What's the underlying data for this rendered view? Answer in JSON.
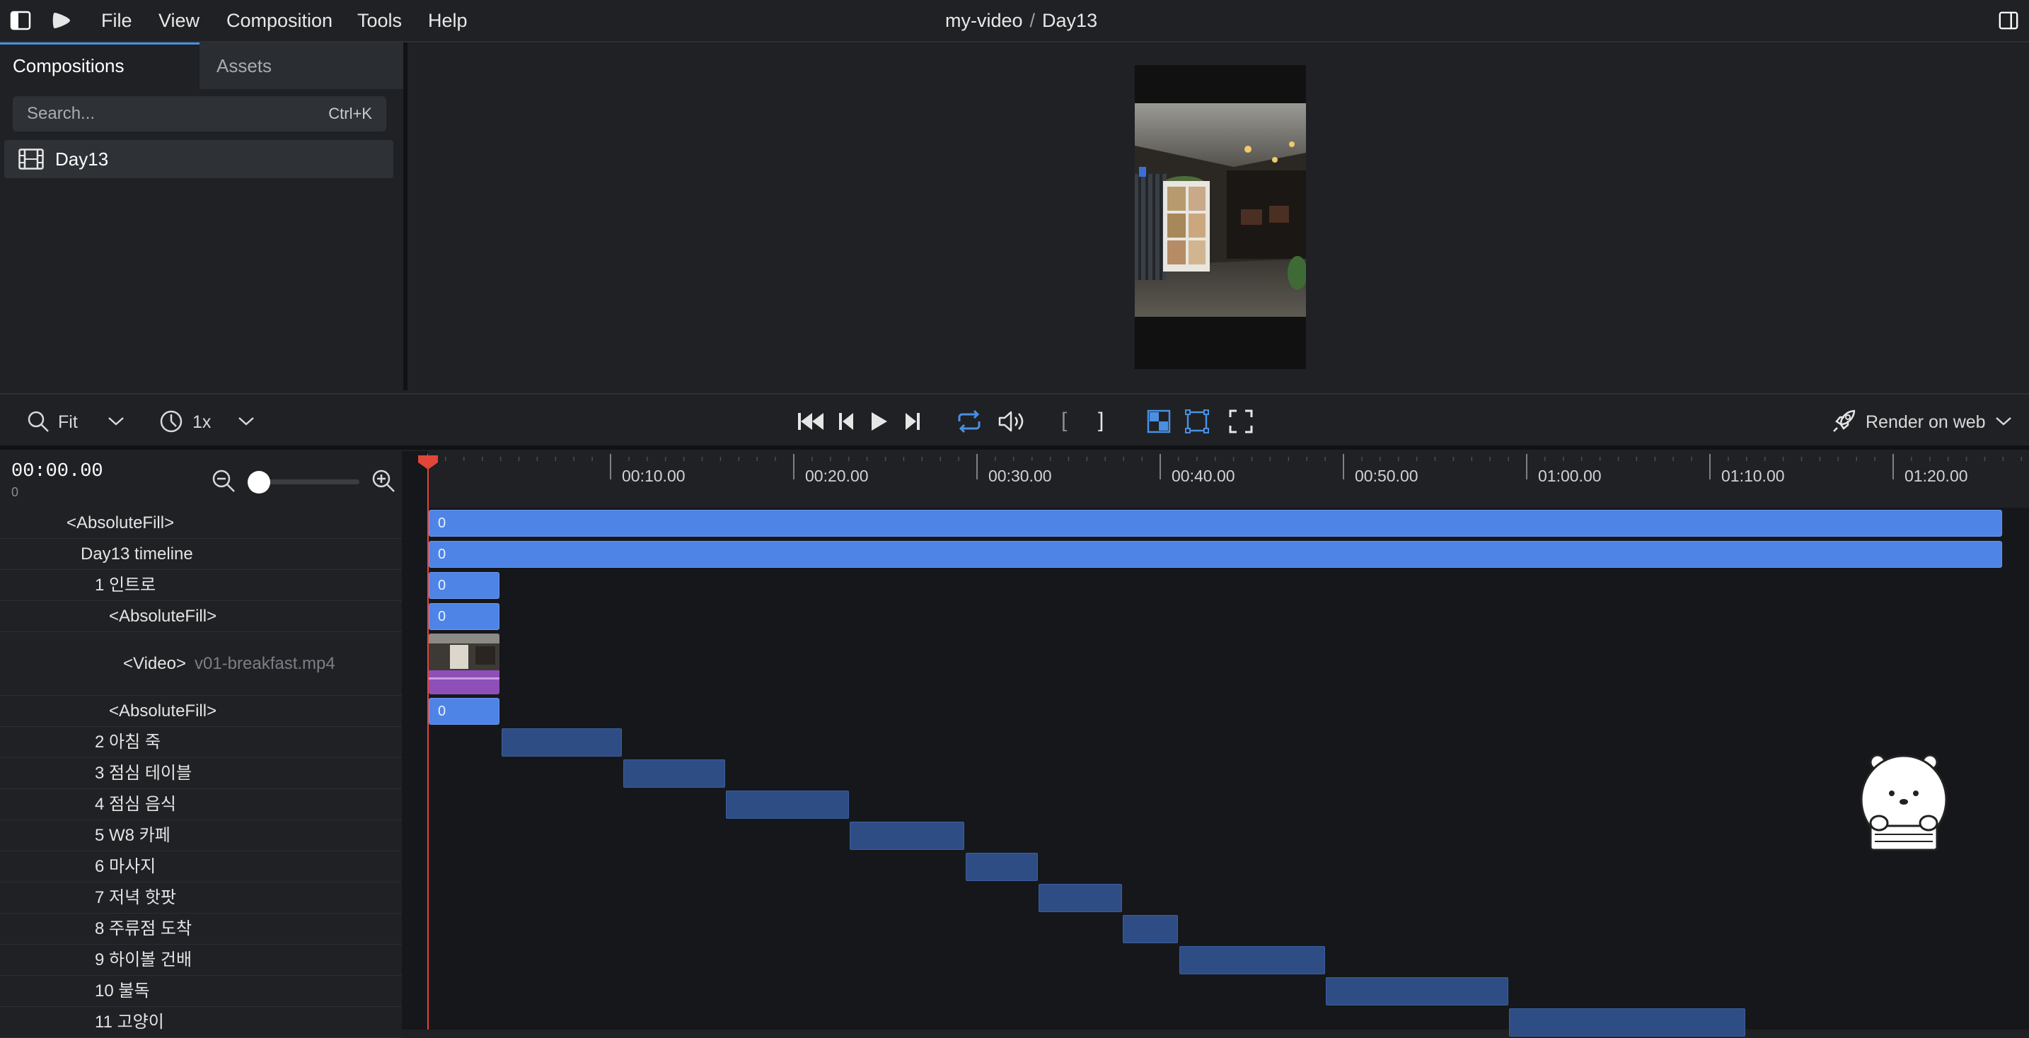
{
  "menubar": {
    "items": [
      "File",
      "View",
      "Composition",
      "Tools",
      "Help"
    ],
    "title_project": "my-video",
    "title_separator": "/",
    "title_composition": "Day13"
  },
  "sidebar": {
    "tabs": [
      "Compositions",
      "Assets"
    ],
    "search_placeholder": "Search...",
    "search_shortcut": "Ctrl+K",
    "compositions": [
      "Day13"
    ]
  },
  "controls": {
    "zoom_label": "Fit",
    "speed_label": "1x",
    "render_label": "Render on web",
    "in_mark": "[",
    "out_mark": "]"
  },
  "timeline": {
    "timecode": "00:00.00",
    "frame": "0",
    "zoom_level": 0.05,
    "ticks": [
      "00:10.00",
      "00:20.00",
      "00:30.00",
      "00:40.00",
      "00:50.00",
      "01:00.00",
      "01:10.00",
      "01:20.00"
    ],
    "rows": [
      {
        "label": "<AbsoluteFill>",
        "bar_text": "0"
      },
      {
        "label": "Day13 timeline",
        "bar_text": "0"
      },
      {
        "label": "1 인트로",
        "bar_text": "0"
      },
      {
        "label": "<AbsoluteFill>",
        "bar_text": "0"
      },
      {
        "label": "<Video>",
        "file": "v01-breakfast.mp4"
      },
      {
        "label": "<AbsoluteFill>",
        "bar_text": "0"
      },
      {
        "label": "2 아침 죽"
      },
      {
        "label": "3 점심 테이블"
      },
      {
        "label": "4 점심 음식"
      },
      {
        "label": "5 W8 카페"
      },
      {
        "label": "6 마사지"
      },
      {
        "label": "7 저녁 핫팟"
      },
      {
        "label": "8 주류점 도착"
      },
      {
        "label": "9 하이볼 건배"
      },
      {
        "label": "10 불독"
      },
      {
        "label": "11 고양이"
      }
    ]
  },
  "colors": {
    "accent": "#4a90e2",
    "bar": "#4e84e6",
    "sequence": "#2f4d85",
    "playhead": "#e0463a",
    "video_clip": "#8e4fb8"
  }
}
